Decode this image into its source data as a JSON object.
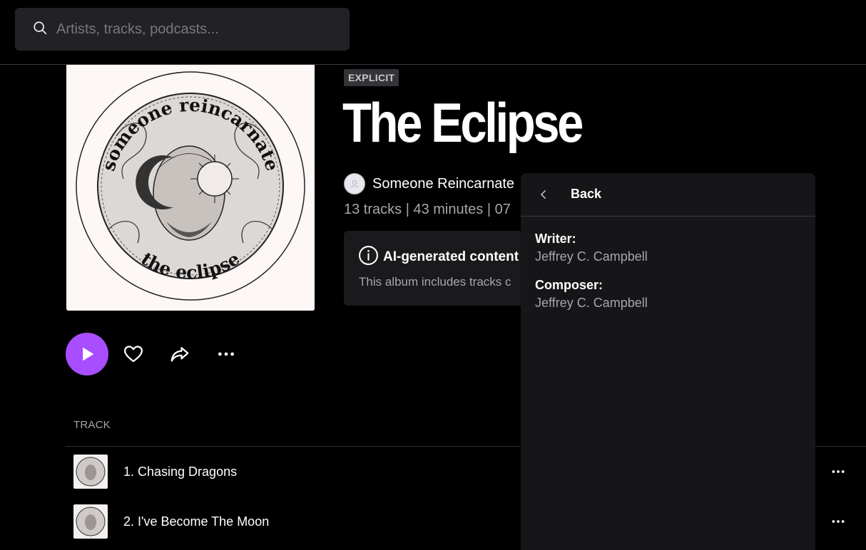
{
  "search": {
    "placeholder": "Artists, tracks, podcasts..."
  },
  "album": {
    "badge": "EXPLICIT",
    "title": "The Eclipse",
    "artist": "Someone Reincarnate",
    "meta": "13 tracks | 43 minutes | 07",
    "art_text_top": "someone reincarnate",
    "art_text_bottom": "the eclipse"
  },
  "ai_notice": {
    "title": "AI-generated content",
    "text": "This album includes tracks c"
  },
  "tracks": {
    "header": "TRACK",
    "items": [
      {
        "title": "1. Chasing Dragons"
      },
      {
        "title": "2. I've Become The Moon"
      }
    ]
  },
  "credits": {
    "back_label": "Back",
    "entries": [
      {
        "role": "Writer:",
        "name": "Jeffrey C. Campbell"
      },
      {
        "role": "Composer:",
        "name": "Jeffrey C. Campbell"
      }
    ]
  },
  "colors": {
    "accent": "#a84dff",
    "background": "#000000",
    "panel": "#161619"
  }
}
